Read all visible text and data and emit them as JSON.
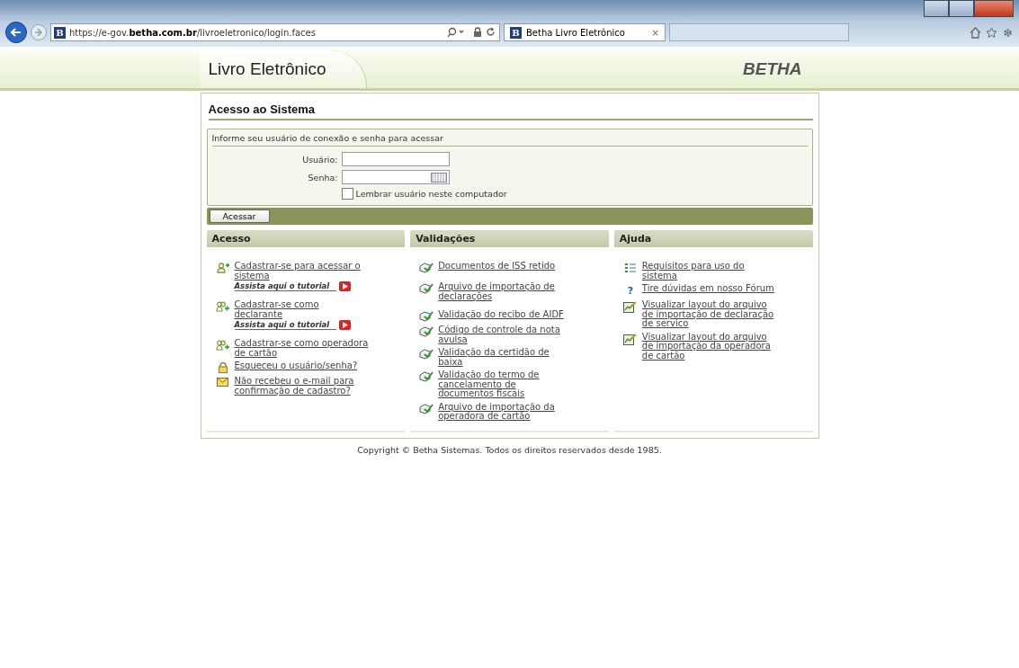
{
  "browser": {
    "url_host": "https://e-gov.",
    "url_domain": "betha.com.br",
    "url_path": "/livroeletronico/login.faces",
    "favicon": "B",
    "tab_favicon": "B",
    "tab_title": "Betha Livro Eletrônico",
    "tab_close": "×"
  },
  "header": {
    "title": "Livro Eletrônico",
    "brand": "BETHA"
  },
  "login": {
    "title": "Acesso ao Sistema",
    "prompt": "Informe seu usuário de conexão e senha para acessar",
    "fields": [
      {
        "label": "Usuário:",
        "kind": "text"
      },
      {
        "label": "Senha:",
        "kind": "password"
      }
    ],
    "remember": {
      "label": "Lembrar usuário neste computador",
      "checked": false
    },
    "submit": "Acessar"
  },
  "columns": [
    {
      "title": "Acesso",
      "links": [
        {
          "kind": "add-user",
          "label": "Cadastrar-se para acessar o sistema",
          "tutorial": "Assista aqui o tutorial"
        },
        {
          "kind": "add-users",
          "label": "Cadastrar-se como declarante",
          "tutorial": "Assista aqui o tutorial"
        },
        {
          "kind": "add-users",
          "label": "Cadastrar-se como operadora de cartão"
        },
        {
          "kind": "lock",
          "label": "Esqueceu o usuário/senha?"
        },
        {
          "kind": "mail",
          "label": "Não recebeu o e-mail para confirmação de cadastro?"
        }
      ]
    },
    {
      "title": "Validações",
      "links": [
        {
          "kind": "check",
          "label": "Documentos de ISS retido"
        },
        {
          "kind": "check",
          "label": "Arquivo de importação de declarações"
        },
        {
          "kind": "check",
          "label": "Validação do recibo de AIDF"
        },
        {
          "kind": "check",
          "label": "Código de controle da nota avulsa"
        },
        {
          "kind": "check",
          "label": "Validação da certidão de baixa"
        },
        {
          "kind": "check",
          "label": "Validação do termo de cancelamento de documentos fiscais"
        },
        {
          "kind": "check",
          "label": "Arquivo de importação da operadora de cartão"
        }
      ]
    },
    {
      "title": "Ajuda",
      "links": [
        {
          "kind": "list",
          "label": "Requisitos para uso do sistema"
        },
        {
          "kind": "help",
          "icon_text": "?",
          "label": "Tire dúvidas em nosso Fórum"
        },
        {
          "kind": "layout",
          "label": "Visualizar layout do arquivo de importação de declaração de servico"
        },
        {
          "kind": "layout",
          "label": "Visualizar layout do arquivo de importação da operadora de cartão"
        }
      ]
    }
  ],
  "footer": "Copyright © Betha Sistemas. Todos os direitos reservados desde 1985."
}
